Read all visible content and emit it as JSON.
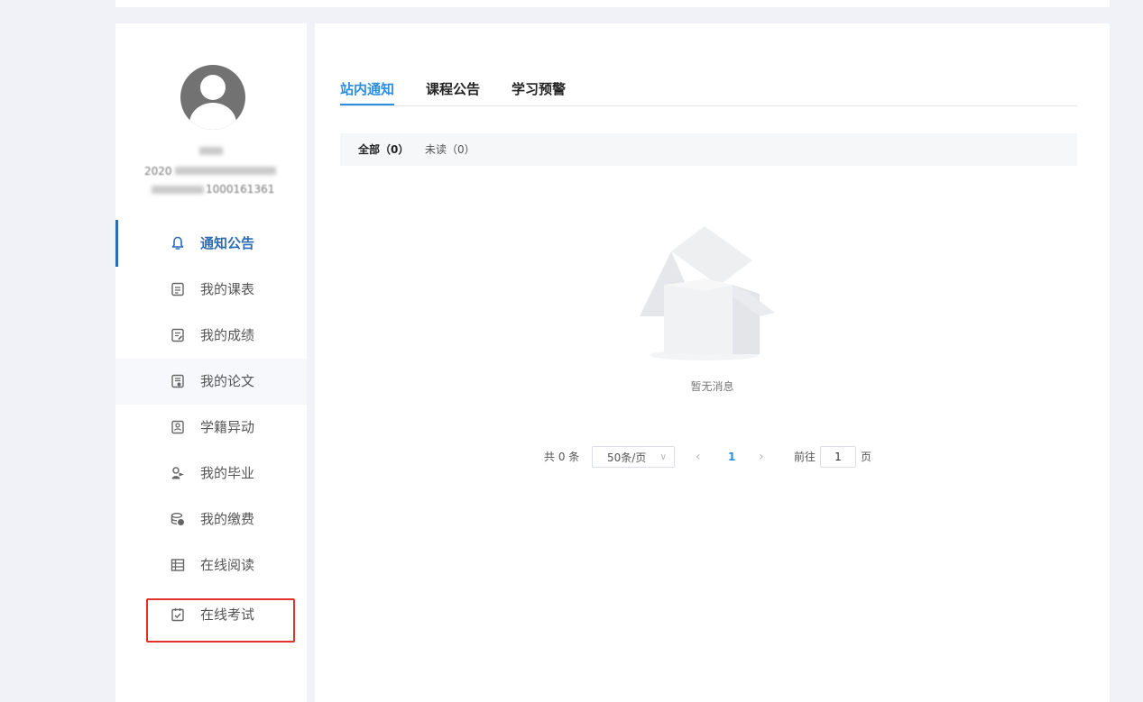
{
  "sidebar": {
    "avatar": "user-avatar-icon",
    "user_name": "",
    "user_line2_prefix": "2020",
    "user_line3_suffix": "1000161361",
    "items": [
      {
        "label": "通知公告",
        "icon": "bell-icon",
        "active": true
      },
      {
        "label": "我的课表",
        "icon": "schedule-icon"
      },
      {
        "label": "我的成绩",
        "icon": "grades-icon"
      },
      {
        "label": "我的论文",
        "icon": "thesis-icon"
      },
      {
        "label": "学籍异动",
        "icon": "status-change-icon"
      },
      {
        "label": "我的毕业",
        "icon": "graduation-icon"
      },
      {
        "label": "我的缴费",
        "icon": "payment-icon"
      },
      {
        "label": "在线阅读",
        "icon": "reading-icon"
      },
      {
        "label": "在线考试",
        "icon": "exam-icon",
        "highlighted": true
      }
    ]
  },
  "main": {
    "tabs": [
      {
        "label": "站内通知",
        "active": true
      },
      {
        "label": "课程公告"
      },
      {
        "label": "学习预警"
      }
    ],
    "filters": {
      "all": "全部（0）",
      "unread": "未读（0）"
    },
    "empty_text": "暂无消息",
    "pagination": {
      "total": "共 0 条",
      "page_size": "50条/页",
      "current_page": "1",
      "goto_label": "前往",
      "goto_value": "1",
      "page_suffix": "页"
    }
  },
  "colors": {
    "accent": "#2d8ee0",
    "sidebar_accent": "#2d6cb5",
    "highlight_border": "#e2322a",
    "page_bg": "#f1f2f7"
  }
}
